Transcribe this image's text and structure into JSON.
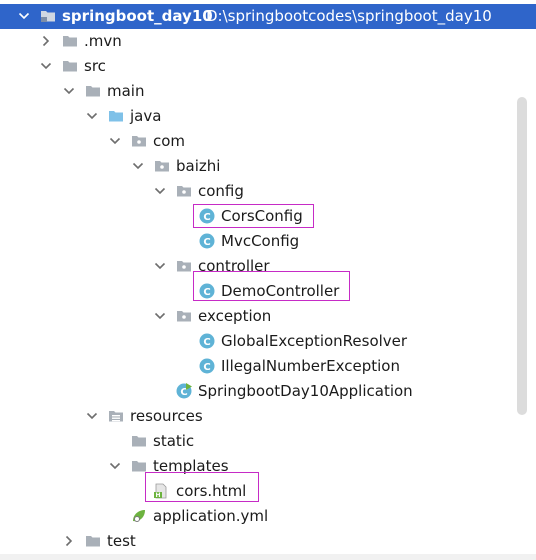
{
  "project": {
    "name": "springboot_day10",
    "path": "D:\\springbootcodes\\springboot_day10"
  },
  "tree": {
    "mvn": ".mvn",
    "src": "src",
    "main": "main",
    "java": "java",
    "com": "com",
    "baizhi": "baizhi",
    "config": "config",
    "cors_config": "CorsConfig",
    "mvc_config": "MvcConfig",
    "controller": "controller",
    "demo_controller": "DemoController",
    "exception": "exception",
    "global_exception_resolver": "GlobalExceptionResolver",
    "illegal_number_exception": "IllegalNumberException",
    "application_class": "SpringbootDay10Application",
    "resources": "resources",
    "static": "static",
    "templates": "templates",
    "cors_html": "cors.html",
    "application_yml": "application.yml",
    "test": "test"
  },
  "colors": {
    "selection": "#2f65ca",
    "highlight_box": "#c62bc6",
    "class_icon": "#5fb3d6",
    "folder_icon": "#a9b0b8",
    "source_folder_icon": "#7fc1e8",
    "spring_green": "#6db33f"
  }
}
